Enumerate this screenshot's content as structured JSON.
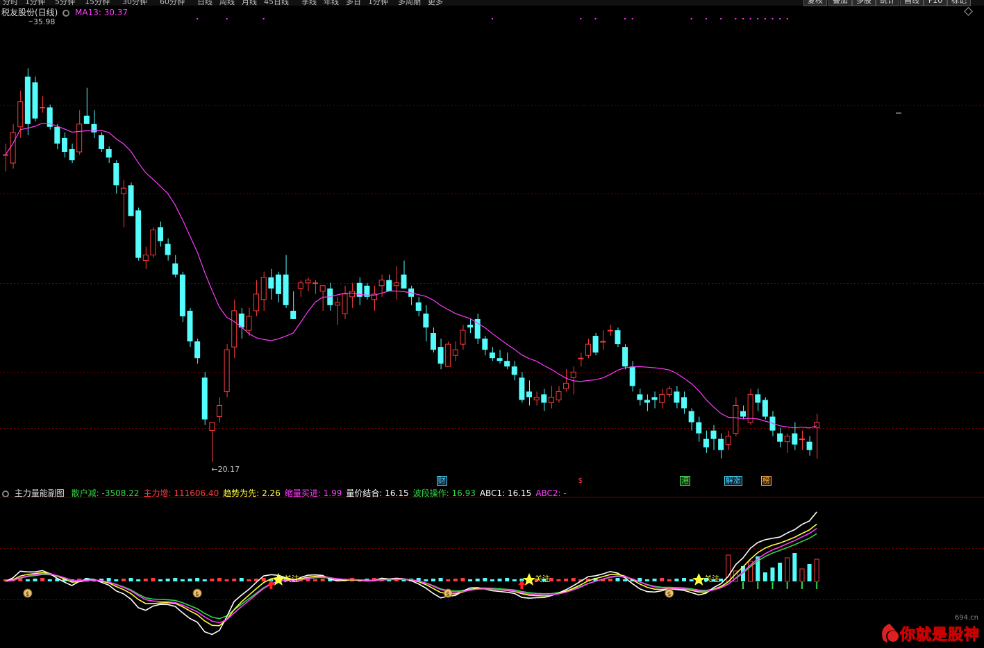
{
  "menu": {
    "items": [
      "分时",
      "1分钟",
      "5分钟",
      "15分钟",
      "30分钟",
      "60分钟",
      "日线",
      "周线",
      "月线",
      "45日线",
      "季线",
      "年线",
      "多日",
      "1分钟",
      "多周期",
      "更多"
    ],
    "right": [
      "复权",
      "叠加",
      "多股",
      "统计",
      "画线",
      "F10",
      "标记"
    ]
  },
  "main_header": {
    "title": "税友股份(日线)",
    "ma_label": "MA13: 30.37",
    "max_label": "35.98",
    "min_label": "←20.17"
  },
  "sub_header": {
    "name": "主力量能副图",
    "items": [
      {
        "label": "散户减: ",
        "value": "-3508.22",
        "color": "#31d846"
      },
      {
        "label": "主力增: ",
        "value": "111606.40",
        "color": "#ff3c3c"
      },
      {
        "label": "趋势为先: ",
        "value": "2.26",
        "color": "#ffff3c"
      },
      {
        "label": "缩量买进: ",
        "value": "1.99",
        "color": "#ff3cff"
      },
      {
        "label": "量价结合: ",
        "value": "16.15",
        "color": "#ffffff"
      },
      {
        "label": "波段操作: ",
        "value": "16.93",
        "color": "#31d846"
      },
      {
        "label": "ABC1: ",
        "value": "16.15",
        "color": "#ffffff"
      },
      {
        "label": "ABC2: ",
        "value": "-",
        "color": "#ff3cff"
      }
    ]
  },
  "flags": [
    {
      "text": "财",
      "color": "#49d2f2",
      "bg": "#1a2030",
      "border": "#49d2f2",
      "i": 59
    },
    {
      "text": "$",
      "color": "#ff3030",
      "bg": "#000",
      "border": "#000",
      "i": 78
    },
    {
      "text": "港",
      "color": "#53e553",
      "bg": "#103010",
      "border": "#53e553",
      "i": 92
    },
    {
      "text": "解涨",
      "color": "#49d2f2",
      "bg": "#102030",
      "border": "#49d2f2",
      "i": 98
    },
    {
      "text": "榜",
      "color": "#ffb040",
      "bg": "#302010",
      "border": "#ffb040",
      "i": 103
    }
  ],
  "signals": [
    {
      "type": "money",
      "i": 3
    },
    {
      "type": "money",
      "i": 26
    },
    {
      "type": "money",
      "i": 60
    },
    {
      "type": "money",
      "i": 90
    },
    {
      "type": "star",
      "i": 37,
      "text": "关注"
    },
    {
      "type": "star",
      "i": 71,
      "text": "关注"
    },
    {
      "type": "star",
      "i": 94,
      "text": "关注"
    },
    {
      "type": "up",
      "i": 36
    },
    {
      "type": "up",
      "i": 70
    }
  ],
  "watermark": {
    "logo_text": "你就是股神",
    "site": "694.cn"
  },
  "colors": {
    "up": "#ff3c3c",
    "down": "#54fcfc",
    "ma": "#ff3cff",
    "grid": "#7a0000",
    "bg": "#000000"
  },
  "chart_data": {
    "type": "candlestick",
    "title": "税友股份(日线)",
    "y_range": [
      19.5,
      37
    ],
    "max_price": 35.98,
    "min_price": 20.17,
    "ohlc": [
      [
        31.2,
        31.6,
        30.6,
        31.2
      ],
      [
        30.9,
        32.3,
        30.7,
        32.0
      ],
      [
        32.2,
        33.5,
        31.8,
        33.1
      ],
      [
        34.0,
        34.3,
        31.9,
        32.3
      ],
      [
        33.8,
        34.0,
        32.4,
        32.5
      ],
      [
        32.9,
        33.3,
        32.7,
        32.9
      ],
      [
        32.9,
        33.0,
        32.1,
        32.2
      ],
      [
        32.2,
        32.3,
        31.4,
        31.6
      ],
      [
        31.8,
        32.0,
        31.1,
        31.3
      ],
      [
        31.4,
        31.6,
        30.9,
        31.0
      ],
      [
        31.3,
        32.8,
        31.2,
        32.3
      ],
      [
        32.6,
        33.6,
        32.3,
        32.3
      ],
      [
        32.3,
        32.8,
        31.8,
        32.0
      ],
      [
        31.9,
        32.0,
        31.3,
        31.4
      ],
      [
        31.4,
        31.5,
        30.9,
        31.1
      ],
      [
        30.9,
        31.0,
        29.8,
        30.1
      ],
      [
        29.8,
        30.3,
        28.6,
        30.0
      ],
      [
        30.1,
        30.2,
        29.1,
        29.0
      ],
      [
        29.2,
        29.3,
        27.4,
        27.5
      ],
      [
        27.4,
        27.9,
        27.1,
        27.6
      ],
      [
        27.6,
        28.6,
        27.5,
        28.5
      ],
      [
        28.6,
        28.8,
        27.9,
        28.1
      ],
      [
        28.0,
        28.2,
        27.4,
        27.6
      ],
      [
        27.3,
        27.6,
        26.8,
        26.9
      ],
      [
        26.9,
        27.0,
        25.2,
        25.4
      ],
      [
        25.6,
        25.7,
        24.3,
        24.5
      ],
      [
        24.5,
        24.6,
        23.7,
        23.9
      ],
      [
        23.2,
        23.4,
        21.5,
        21.7
      ],
      [
        21.3,
        21.6,
        20.17,
        21.6
      ],
      [
        21.8,
        22.5,
        21.6,
        22.2
      ],
      [
        22.7,
        24.4,
        22.5,
        24.2
      ],
      [
        24.3,
        26.0,
        23.9,
        25.6
      ],
      [
        25.5,
        25.7,
        24.6,
        25.0
      ],
      [
        24.9,
        25.7,
        24.7,
        25.4
      ],
      [
        25.6,
        26.7,
        25.4,
        26.2
      ],
      [
        26.0,
        27.0,
        25.6,
        26.8
      ],
      [
        26.8,
        27.1,
        26.0,
        26.4
      ],
      [
        26.9,
        27.0,
        25.9,
        26.2
      ],
      [
        26.9,
        27.6,
        25.7,
        25.8
      ],
      [
        25.6,
        26.3,
        25.5,
        25.3
      ],
      [
        26.4,
        26.7,
        26.1,
        26.6
      ],
      [
        26.6,
        26.8,
        26.3,
        26.7
      ],
      [
        26.6,
        26.7,
        26.2,
        26.6
      ],
      [
        26.3,
        26.4,
        25.6,
        26.5
      ],
      [
        26.4,
        26.6,
        25.6,
        25.8
      ],
      [
        25.8,
        26.1,
        25.1,
        25.9
      ],
      [
        25.5,
        26.5,
        25.3,
        26.2
      ],
      [
        26.1,
        26.6,
        25.7,
        26.3
      ],
      [
        26.6,
        26.8,
        25.8,
        26.1
      ],
      [
        26.5,
        26.6,
        26.0,
        26.1
      ],
      [
        26.0,
        26.5,
        25.6,
        26.2
      ],
      [
        26.5,
        26.9,
        26.1,
        26.7
      ],
      [
        26.7,
        26.9,
        26.3,
        26.3
      ],
      [
        26.5,
        27.2,
        26.0,
        26.6
      ],
      [
        26.9,
        27.4,
        26.4,
        26.4
      ],
      [
        26.4,
        26.5,
        25.8,
        26.1
      ],
      [
        25.9,
        26.1,
        25.4,
        25.6
      ],
      [
        25.5,
        25.8,
        24.5,
        25.0
      ],
      [
        24.8,
        25.0,
        24.1,
        24.2
      ],
      [
        24.3,
        24.6,
        23.5,
        23.7
      ],
      [
        23.6,
        24.5,
        23.6,
        24.4
      ],
      [
        24.0,
        24.5,
        23.8,
        24.2
      ],
      [
        24.4,
        25.1,
        24.2,
        24.9
      ],
      [
        25.1,
        25.3,
        24.8,
        25.0
      ],
      [
        25.3,
        25.5,
        24.4,
        24.6
      ],
      [
        24.6,
        24.7,
        24.0,
        24.2
      ],
      [
        24.1,
        24.3,
        23.8,
        23.9
      ],
      [
        23.9,
        24.2,
        23.7,
        23.8
      ],
      [
        23.8,
        24.1,
        23.5,
        23.6
      ],
      [
        23.6,
        23.8,
        23.1,
        23.3
      ],
      [
        23.2,
        23.4,
        22.3,
        22.4
      ],
      [
        22.7,
        23.1,
        22.2,
        22.5
      ],
      [
        22.4,
        22.7,
        22.2,
        22.5
      ],
      [
        22.6,
        22.8,
        22.0,
        22.3
      ],
      [
        22.3,
        22.9,
        22.1,
        22.5
      ],
      [
        22.4,
        22.9,
        22.3,
        22.7
      ],
      [
        22.8,
        23.5,
        22.7,
        23.0
      ],
      [
        23.2,
        23.6,
        22.6,
        23.4
      ],
      [
        23.9,
        24.1,
        23.6,
        23.9
      ],
      [
        24.0,
        24.6,
        23.9,
        24.4
      ],
      [
        24.7,
        24.8,
        24.0,
        24.1
      ],
      [
        24.5,
        24.9,
        24.2,
        24.5
      ],
      [
        24.9,
        25.1,
        24.7,
        24.9
      ],
      [
        24.9,
        25.0,
        24.3,
        24.4
      ],
      [
        24.3,
        24.4,
        23.5,
        23.6
      ],
      [
        23.6,
        23.8,
        22.7,
        22.9
      ],
      [
        22.6,
        22.8,
        22.2,
        22.4
      ],
      [
        22.4,
        22.6,
        22.0,
        22.3
      ],
      [
        22.5,
        22.7,
        22.1,
        22.4
      ],
      [
        22.3,
        22.8,
        22.1,
        22.6
      ],
      [
        22.6,
        22.9,
        22.5,
        22.8
      ],
      [
        22.7,
        22.9,
        22.1,
        22.3
      ],
      [
        22.5,
        22.7,
        21.9,
        22.1
      ],
      [
        22.0,
        22.1,
        21.3,
        21.6
      ],
      [
        21.6,
        21.8,
        20.9,
        21.2
      ],
      [
        21.0,
        21.3,
        20.5,
        20.7
      ],
      [
        21.3,
        21.5,
        20.6,
        21.0
      ],
      [
        21.0,
        21.2,
        20.3,
        20.6
      ],
      [
        20.8,
        21.3,
        20.6,
        21.1
      ],
      [
        21.2,
        22.5,
        21.1,
        22.2
      ],
      [
        22.0,
        22.2,
        21.7,
        21.8
      ],
      [
        21.6,
        22.8,
        21.5,
        22.6
      ],
      [
        22.6,
        22.8,
        22.0,
        22.3
      ],
      [
        22.4,
        22.5,
        21.7,
        21.8
      ],
      [
        21.8,
        22.0,
        21.1,
        21.3
      ],
      [
        21.2,
        21.4,
        20.7,
        20.9
      ],
      [
        20.9,
        21.2,
        20.5,
        21.1
      ],
      [
        21.2,
        21.6,
        20.6,
        20.8
      ],
      [
        21.0,
        21.3,
        20.6,
        21.0
      ],
      [
        20.9,
        21.1,
        20.4,
        20.6
      ],
      [
        21.4,
        21.9,
        20.3,
        21.6
      ]
    ]
  }
}
